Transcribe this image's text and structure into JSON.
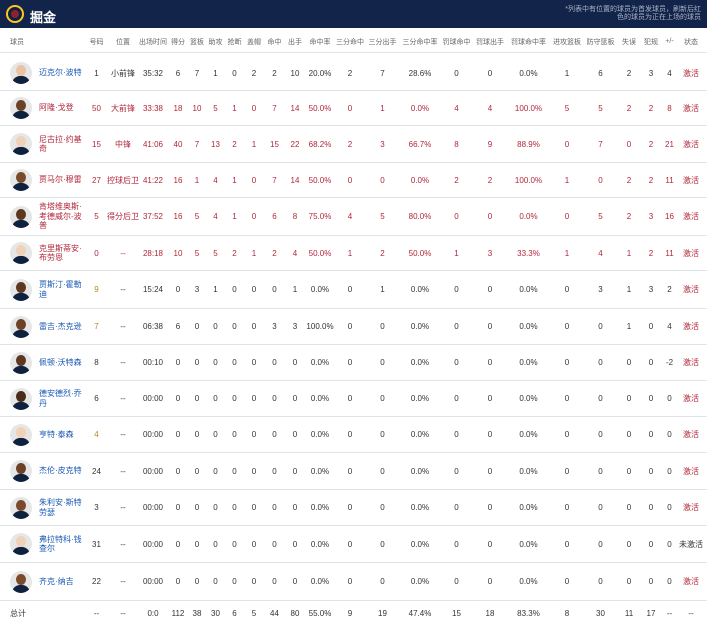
{
  "header": {
    "team_name": "掘金",
    "note": "*列表中有位置的球员为首发球员，刷新后红色的球员为正在上场的球员"
  },
  "columns": [
    "球员",
    "号码",
    "位置",
    "出场时间",
    "得分",
    "篮板",
    "助攻",
    "抢断",
    "盖帽",
    "命中",
    "出手",
    "命中率",
    "三分命中",
    "三分出手",
    "三分命中率",
    "罚球命中",
    "罚球出手",
    "罚球命中率",
    "进攻篮板",
    "防守篮板",
    "失误",
    "犯规",
    "+/-",
    "状态"
  ],
  "players": [
    {
      "name": "迈克尔·波特",
      "num": "1",
      "pos": "小前锋",
      "min": "35:32",
      "pts": "6",
      "reb": "7",
      "ast": "1",
      "stl": "0",
      "blk": "2",
      "fgm": "2",
      "fga": "10",
      "fgp": "20.0%",
      "tpm": "2",
      "tpa": "7",
      "tpp": "28.6%",
      "ftm": "0",
      "fta": "0",
      "ftp": "0.0%",
      "oreb": "1",
      "dreb": "6",
      "tov": "2",
      "pf": "3",
      "pm": "4",
      "status": "激活",
      "starter": false,
      "skin": "#e8c4a4"
    },
    {
      "name": "阿隆·戈登",
      "num": "50",
      "pos": "大前锋",
      "min": "33:38",
      "pts": "18",
      "reb": "10",
      "ast": "5",
      "stl": "1",
      "blk": "0",
      "fgm": "7",
      "fga": "14",
      "fgp": "50.0%",
      "tpm": "0",
      "tpa": "1",
      "tpp": "0.0%",
      "ftm": "4",
      "fta": "4",
      "ftp": "100.0%",
      "oreb": "5",
      "dreb": "5",
      "tov": "2",
      "pf": "2",
      "pm": "8",
      "status": "激活",
      "starter": true,
      "skin": "#6b4226"
    },
    {
      "name": "尼古拉·约基奇",
      "num": "15",
      "pos": "中锋",
      "min": "41:06",
      "pts": "40",
      "reb": "7",
      "ast": "13",
      "stl": "2",
      "blk": "1",
      "fgm": "15",
      "fga": "22",
      "fgp": "68.2%",
      "tpm": "2",
      "tpa": "3",
      "tpp": "66.7%",
      "ftm": "8",
      "fta": "9",
      "ftp": "88.9%",
      "oreb": "0",
      "dreb": "7",
      "tov": "0",
      "pf": "2",
      "pm": "21",
      "status": "激活",
      "starter": true,
      "skin": "#efd2b8"
    },
    {
      "name": "贾马尔·穆雷",
      "num": "27",
      "pos": "控球后卫",
      "min": "41:22",
      "pts": "16",
      "reb": "1",
      "ast": "4",
      "stl": "1",
      "blk": "0",
      "fgm": "7",
      "fga": "14",
      "fgp": "50.0%",
      "tpm": "0",
      "tpa": "0",
      "tpp": "0.0%",
      "ftm": "2",
      "fta": "2",
      "ftp": "100.0%",
      "oreb": "1",
      "dreb": "0",
      "tov": "2",
      "pf": "2",
      "pm": "11",
      "status": "激活",
      "starter": true,
      "skin": "#7a4a2c"
    },
    {
      "name": "肯塔维奥斯·考德威尔-波普",
      "num": "5",
      "pos": "得分后卫",
      "min": "37:52",
      "pts": "16",
      "reb": "5",
      "ast": "4",
      "stl": "1",
      "blk": "0",
      "fgm": "6",
      "fga": "8",
      "fgp": "75.0%",
      "tpm": "4",
      "tpa": "5",
      "tpp": "80.0%",
      "ftm": "0",
      "fta": "0",
      "ftp": "0.0%",
      "oreb": "0",
      "dreb": "5",
      "tov": "2",
      "pf": "3",
      "pm": "16",
      "status": "激活",
      "starter": true,
      "skin": "#5c3820"
    },
    {
      "name": "克里斯蒂安·布劳恩",
      "num": "0",
      "pos": "--",
      "min": "28:18",
      "pts": "10",
      "reb": "5",
      "ast": "5",
      "stl": "2",
      "blk": "1",
      "fgm": "2",
      "fga": "4",
      "fgp": "50.0%",
      "tpm": "1",
      "tpa": "2",
      "tpp": "50.0%",
      "ftm": "1",
      "fta": "3",
      "ftp": "33.3%",
      "oreb": "1",
      "dreb": "4",
      "tov": "1",
      "pf": "2",
      "pm": "11",
      "status": "激活",
      "starter": true,
      "skin": "#efd2b8"
    },
    {
      "name": "贾斯汀·霍勒迪",
      "num": "9",
      "pos": "--",
      "min": "15:24",
      "pts": "0",
      "reb": "3",
      "ast": "1",
      "stl": "0",
      "blk": "0",
      "fgm": "0",
      "fga": "1",
      "fgp": "0.0%",
      "tpm": "0",
      "tpa": "1",
      "tpp": "0.0%",
      "ftm": "0",
      "fta": "0",
      "ftp": "0.0%",
      "oreb": "0",
      "dreb": "3",
      "tov": "1",
      "pf": "3",
      "pm": "2",
      "status": "激活",
      "starter": false,
      "skin": "#5c3820"
    },
    {
      "name": "雷吉·杰克逊",
      "num": "7",
      "pos": "--",
      "min": "06:38",
      "pts": "6",
      "reb": "0",
      "ast": "0",
      "stl": "0",
      "blk": "0",
      "fgm": "3",
      "fga": "3",
      "fgp": "100.0%",
      "tpm": "0",
      "tpa": "0",
      "tpp": "0.0%",
      "ftm": "0",
      "fta": "0",
      "ftp": "0.0%",
      "oreb": "0",
      "dreb": "0",
      "tov": "1",
      "pf": "0",
      "pm": "4",
      "status": "激活",
      "starter": false,
      "skin": "#6b4226"
    },
    {
      "name": "佩顿·沃特森",
      "num": "8",
      "pos": "--",
      "min": "00:10",
      "pts": "0",
      "reb": "0",
      "ast": "0",
      "stl": "0",
      "blk": "0",
      "fgm": "0",
      "fga": "0",
      "fgp": "0.0%",
      "tpm": "0",
      "tpa": "0",
      "tpp": "0.0%",
      "ftm": "0",
      "fta": "0",
      "ftp": "0.0%",
      "oreb": "0",
      "dreb": "0",
      "tov": "0",
      "pf": "0",
      "pm": "-2",
      "status": "激活",
      "starter": false,
      "skin": "#5c3820"
    },
    {
      "name": "德安德烈·乔丹",
      "num": "6",
      "pos": "--",
      "min": "00:00",
      "pts": "0",
      "reb": "0",
      "ast": "0",
      "stl": "0",
      "blk": "0",
      "fgm": "0",
      "fga": "0",
      "fgp": "0.0%",
      "tpm": "0",
      "tpa": "0",
      "tpp": "0.0%",
      "ftm": "0",
      "fta": "0",
      "ftp": "0.0%",
      "oreb": "0",
      "dreb": "0",
      "tov": "0",
      "pf": "0",
      "pm": "0",
      "status": "激活",
      "starter": false,
      "skin": "#4a2c18"
    },
    {
      "name": "亨特·泰森",
      "num": "4",
      "pos": "--",
      "min": "00:00",
      "pts": "0",
      "reb": "0",
      "ast": "0",
      "stl": "0",
      "blk": "0",
      "fgm": "0",
      "fga": "0",
      "fgp": "0.0%",
      "tpm": "0",
      "tpa": "0",
      "tpp": "0.0%",
      "ftm": "0",
      "fta": "0",
      "ftp": "0.0%",
      "oreb": "0",
      "dreb": "0",
      "tov": "0",
      "pf": "0",
      "pm": "0",
      "status": "激活",
      "starter": false,
      "skin": "#efd2b8"
    },
    {
      "name": "杰伦·皮克特",
      "num": "24",
      "pos": "--",
      "min": "00:00",
      "pts": "0",
      "reb": "0",
      "ast": "0",
      "stl": "0",
      "blk": "0",
      "fgm": "0",
      "fga": "0",
      "fgp": "0.0%",
      "tpm": "0",
      "tpa": "0",
      "tpp": "0.0%",
      "ftm": "0",
      "fta": "0",
      "ftp": "0.0%",
      "oreb": "0",
      "dreb": "0",
      "tov": "0",
      "pf": "0",
      "pm": "0",
      "status": "激活",
      "starter": false,
      "skin": "#6b4226"
    },
    {
      "name": "朱利安·斯特劳瑟",
      "num": "3",
      "pos": "--",
      "min": "00:00",
      "pts": "0",
      "reb": "0",
      "ast": "0",
      "stl": "0",
      "blk": "0",
      "fgm": "0",
      "fga": "0",
      "fgp": "0.0%",
      "tpm": "0",
      "tpa": "0",
      "tpp": "0.0%",
      "ftm": "0",
      "fta": "0",
      "ftp": "0.0%",
      "oreb": "0",
      "dreb": "0",
      "tov": "0",
      "pf": "0",
      "pm": "0",
      "status": "激活",
      "starter": false,
      "skin": "#7a4a2c"
    },
    {
      "name": "弗拉特科·钱查尔",
      "num": "31",
      "pos": "--",
      "min": "00:00",
      "pts": "0",
      "reb": "0",
      "ast": "0",
      "stl": "0",
      "blk": "0",
      "fgm": "0",
      "fga": "0",
      "fgp": "0.0%",
      "tpm": "0",
      "tpa": "0",
      "tpp": "0.0%",
      "ftm": "0",
      "fta": "0",
      "ftp": "0.0%",
      "oreb": "0",
      "dreb": "0",
      "tov": "0",
      "pf": "0",
      "pm": "0",
      "status": "未激活",
      "starter": false,
      "skin": "#efd2b8"
    },
    {
      "name": "齐克·纳吉",
      "num": "22",
      "pos": "--",
      "min": "00:00",
      "pts": "0",
      "reb": "0",
      "ast": "0",
      "stl": "0",
      "blk": "0",
      "fgm": "0",
      "fga": "0",
      "fgp": "0.0%",
      "tpm": "0",
      "tpa": "0",
      "tpp": "0.0%",
      "ftm": "0",
      "fta": "0",
      "ftp": "0.0%",
      "oreb": "0",
      "dreb": "0",
      "tov": "0",
      "pf": "0",
      "pm": "0",
      "status": "激活",
      "starter": false,
      "skin": "#7a4a2c"
    }
  ],
  "totals": {
    "label": "总计",
    "num": "--",
    "pos": "--",
    "min": "0:0",
    "pts": "112",
    "reb": "38",
    "ast": "30",
    "stl": "6",
    "blk": "5",
    "fgm": "44",
    "fga": "80",
    "fgp": "55.0%",
    "tpm": "9",
    "tpa": "19",
    "tpp": "47.4%",
    "ftm": "15",
    "fta": "18",
    "ftp": "83.3%",
    "oreb": "8",
    "dreb": "30",
    "tov": "11",
    "pf": "17",
    "pm": "--",
    "status": "--"
  }
}
